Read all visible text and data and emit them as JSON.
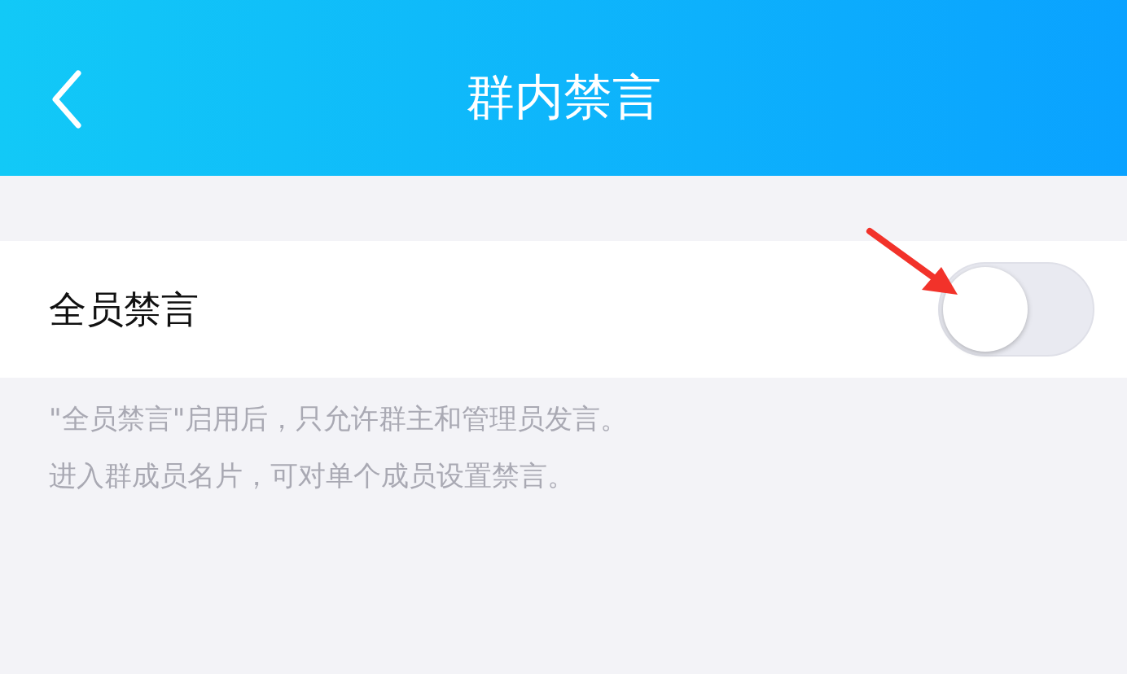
{
  "header": {
    "title": "群内禁言"
  },
  "settings": [
    {
      "kind": "toggle",
      "label": "全员禁言",
      "on": false
    }
  ],
  "hints": [
    "\"全员禁言\"启用后，只允许群主和管理员发言。",
    "进入群成员名片，可对单个成员设置禁言。"
  ]
}
